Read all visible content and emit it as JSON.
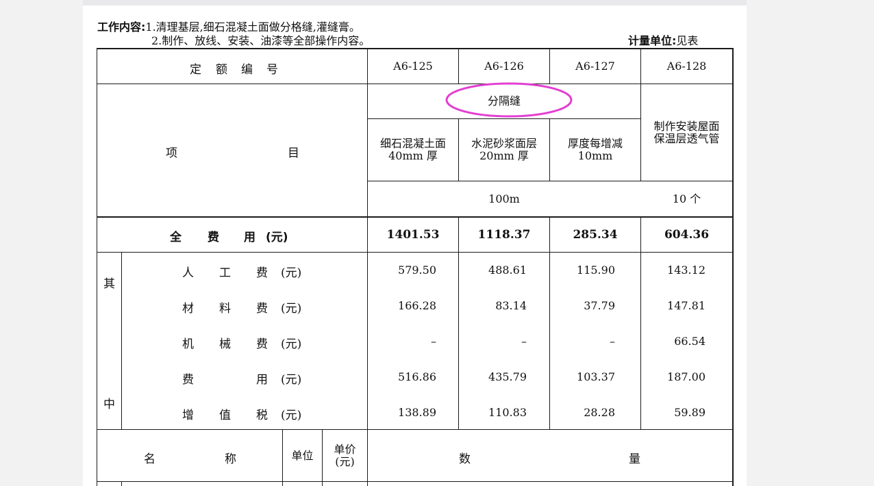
{
  "header": {
    "work_label": "工作内容:",
    "work_line1": "1.清理基层,细石混凝土面做分格缝,灌缝膏。",
    "work_line2": "2.制作、放线、安装、油漆等全部操作内容。",
    "unit_label": "计量单位:",
    "unit_value": "见表"
  },
  "table": {
    "code_label": [
      "定",
      "额",
      "编",
      "号"
    ],
    "codes": [
      "A6-125",
      "A6-126",
      "A6-127",
      "A6-128"
    ],
    "item_label": [
      "项",
      "目"
    ],
    "group_label": "分隔缝",
    "sub_items": [
      [
        "细石混凝土面",
        "40mm 厚"
      ],
      [
        "水泥砂浆面层",
        "20mm 厚"
      ],
      [
        "厚度每增减",
        "10mm"
      ]
    ],
    "pipe_item": [
      "制作安装屋面",
      "保温层透气管"
    ],
    "unit_group": "100m",
    "unit_pipe": "10 个",
    "total_label": [
      "全",
      "费",
      "用",
      "(元)"
    ],
    "totals": [
      "1401.53",
      "1118.37",
      "285.34",
      "604.36"
    ],
    "side_top": "其",
    "side_bottom": "中",
    "rows": [
      {
        "chars": [
          "人",
          "工",
          "费"
        ],
        "unit": "(元)",
        "values": [
          "579.50",
          "488.61",
          "115.90",
          "143.12"
        ]
      },
      {
        "chars": [
          "材",
          "料",
          "费"
        ],
        "unit": "(元)",
        "values": [
          "166.28",
          "83.14",
          "37.79",
          "147.81"
        ]
      },
      {
        "chars": [
          "机",
          "械",
          "费"
        ],
        "unit": "(元)",
        "values": [
          "–",
          "–",
          "–",
          "66.54"
        ]
      },
      {
        "chars": [
          "费",
          "",
          "用"
        ],
        "unit": "(元)",
        "values": [
          "516.86",
          "435.79",
          "103.37",
          "187.00"
        ]
      },
      {
        "chars": [
          "增",
          "值",
          "税"
        ],
        "unit": "(元)",
        "values": [
          "138.89",
          "110.83",
          "28.28",
          "59.89"
        ]
      }
    ],
    "bottom_header": {
      "name": [
        "名",
        "称"
      ],
      "unit": "单位",
      "price": [
        "单价",
        "(元)"
      ],
      "qty": [
        "数",
        "量"
      ]
    }
  },
  "annotation_color": "#e23fd2"
}
